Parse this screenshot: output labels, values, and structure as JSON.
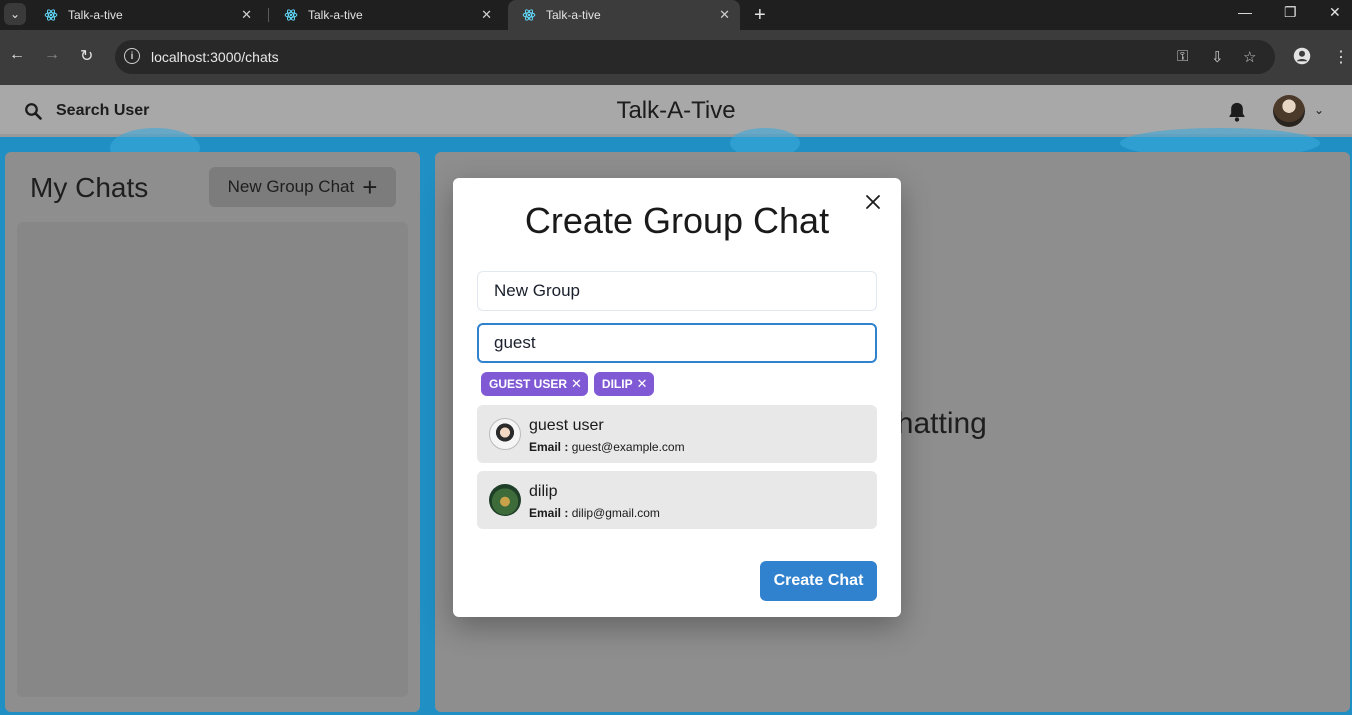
{
  "browser": {
    "tabs": [
      {
        "title": "Talk-a-tive"
      },
      {
        "title": "Talk-a-tive"
      },
      {
        "title": "Talk-a-tive"
      }
    ],
    "url": "localhost:3000/chats"
  },
  "header": {
    "search_label": "Search User",
    "app_title": "Talk-A-Tive"
  },
  "sidebar": {
    "title": "My Chats",
    "new_group_label": "New Group Chat"
  },
  "main": {
    "placeholder": "Click on a user to start chatting"
  },
  "modal": {
    "title": "Create Group Chat",
    "group_name_value": "New Group",
    "search_value": "guest",
    "selected_users": [
      {
        "label": "GUEST USER"
      },
      {
        "label": "DILIP"
      }
    ],
    "results": [
      {
        "name": "guest user",
        "email_label": "Email :",
        "email": "guest@example.com"
      },
      {
        "name": "dilip",
        "email_label": "Email :",
        "email": "dilip@gmail.com"
      }
    ],
    "create_label": "Create Chat"
  },
  "colors": {
    "accent": "#3182ce",
    "badge": "#805ad5",
    "background": "#1f8fc4"
  }
}
